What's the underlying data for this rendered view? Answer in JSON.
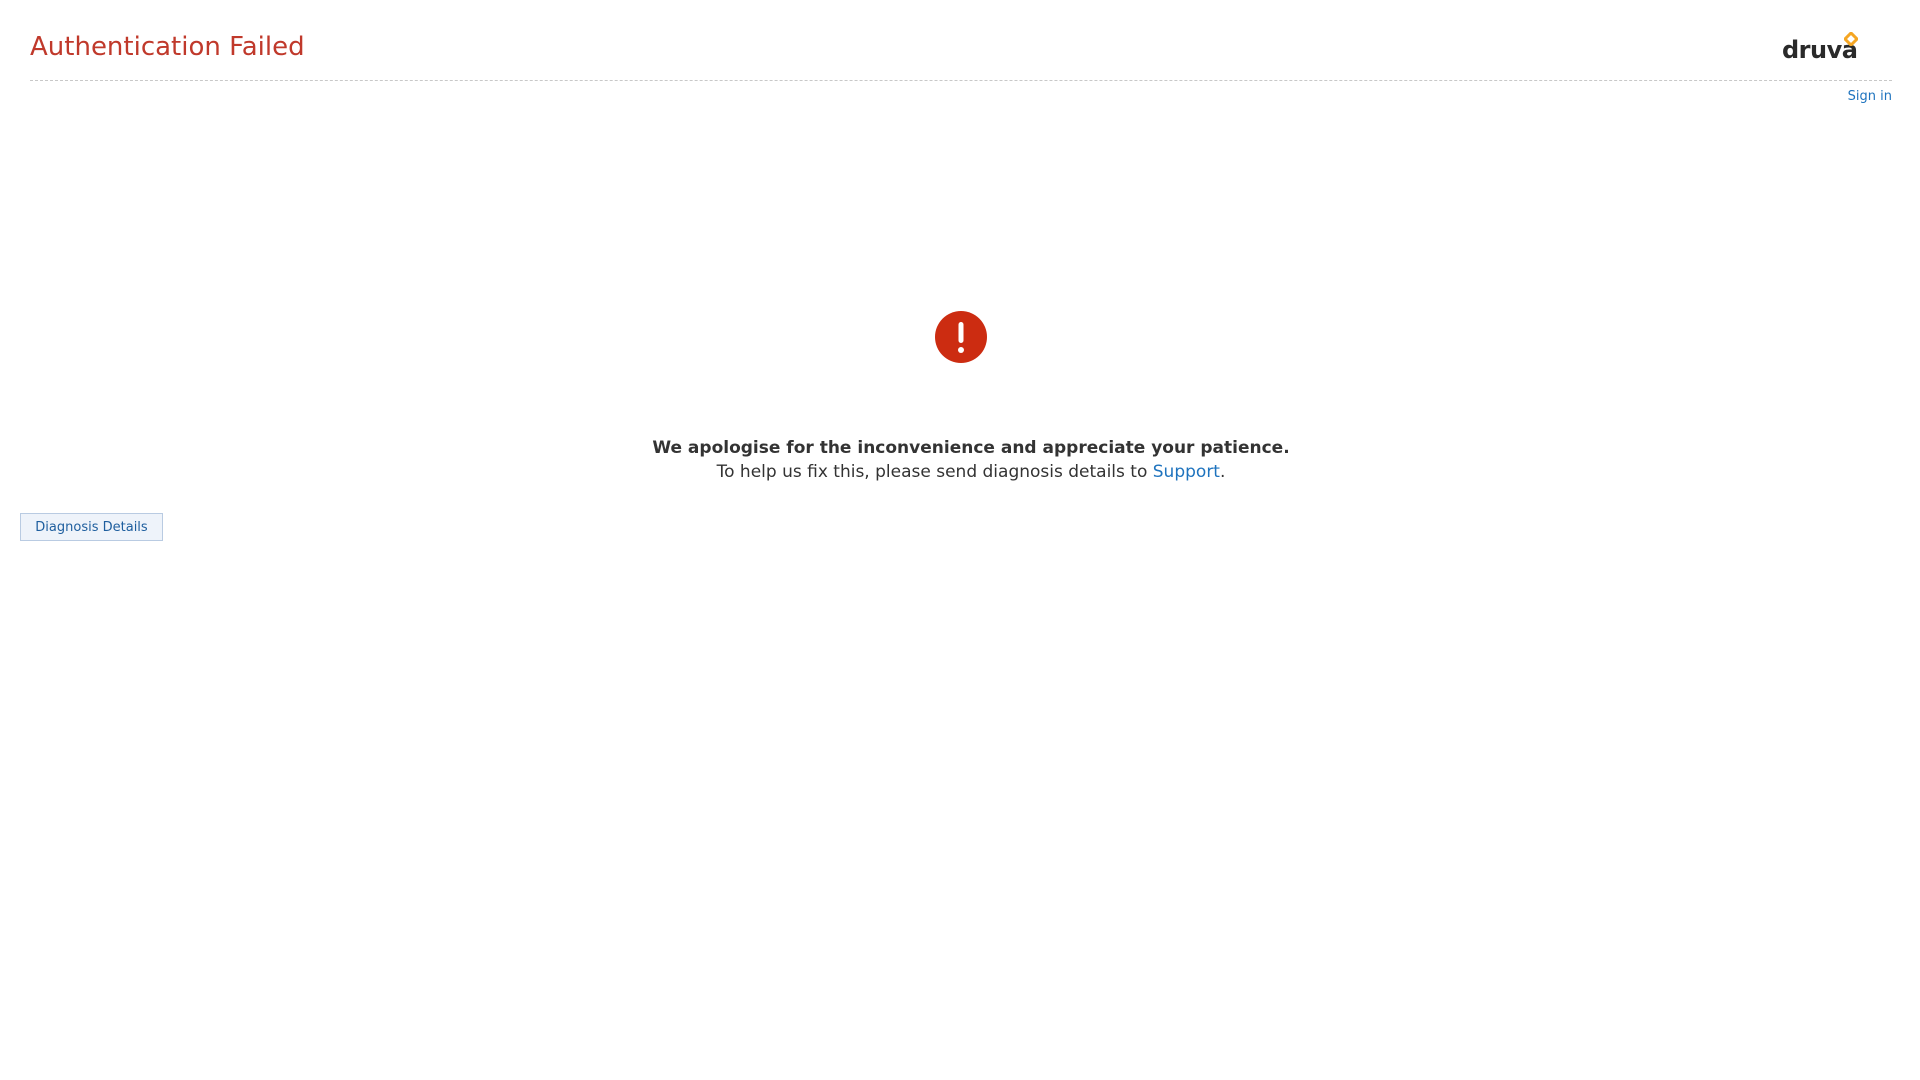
{
  "header": {
    "title": "Authentication Failed",
    "logo_text": "druva"
  },
  "nav": {
    "sign_in": "Sign in"
  },
  "error": {
    "icon": "exclamation-circle-icon",
    "icon_color": "#cc2c11",
    "headline": "We apologise for the inconvenience and appreciate your patience.",
    "detail_prefix": "To help us fix this, please send diagnosis details to ",
    "support_link": "Support",
    "detail_suffix": "."
  },
  "actions": {
    "diagnosis_button": "Diagnosis Details"
  },
  "colors": {
    "title": "#c0392b",
    "link": "#1e73be",
    "logo_accent": "#f5a623"
  }
}
